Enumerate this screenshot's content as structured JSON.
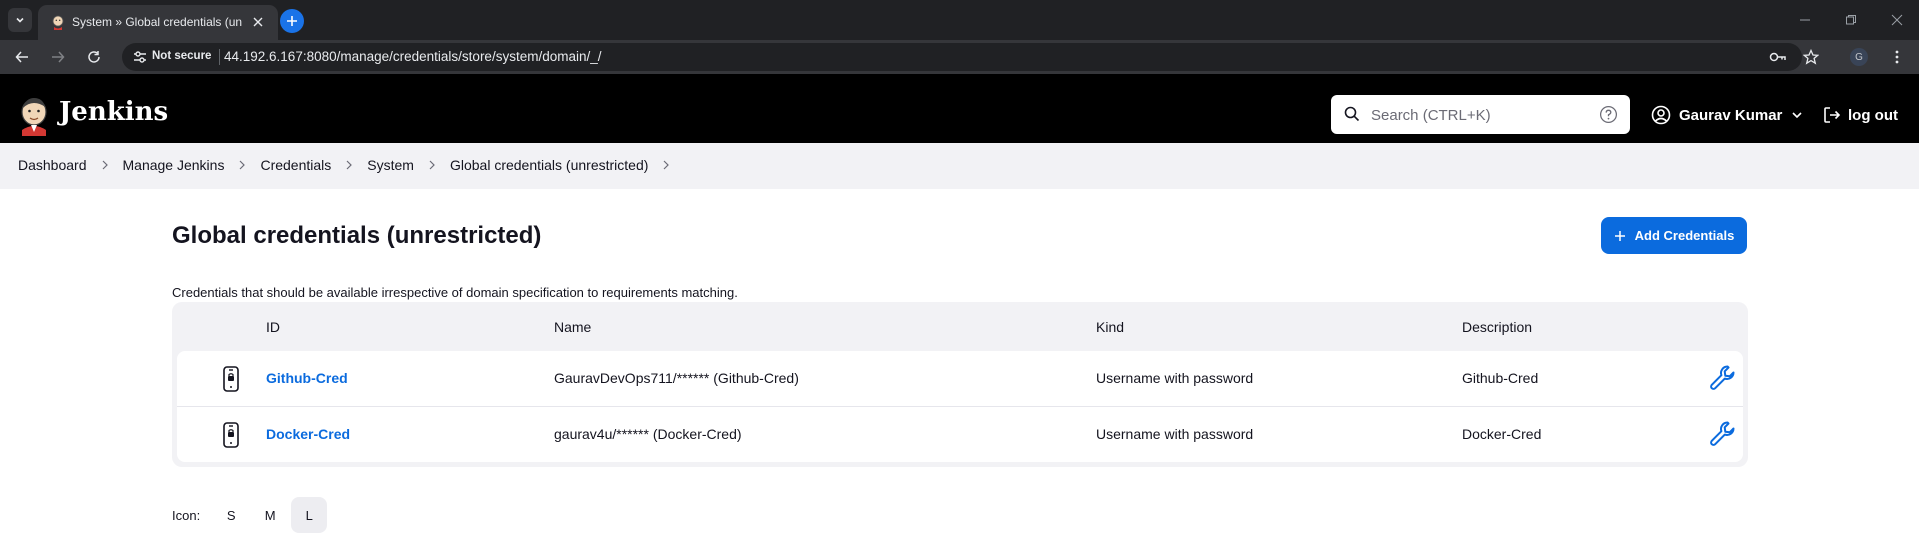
{
  "browser": {
    "tab_title": "System » Global credentials (unrestricted)",
    "security_label": "Not secure",
    "url": "44.192.6.167:8080/manage/credentials/store/system/domain/_/",
    "profile_initial": "G"
  },
  "header": {
    "app_name": "Jenkins",
    "search_placeholder": "Search (CTRL+K)",
    "user_name": "Gaurav Kumar",
    "logout_label": "log out"
  },
  "breadcrumb": [
    "Dashboard",
    "Manage Jenkins",
    "Credentials",
    "System",
    "Global credentials (unrestricted)"
  ],
  "main": {
    "title": "Global credentials (unrestricted)",
    "add_button_label": "Add Credentials",
    "description": "Credentials that should be available irrespective of domain specification to requirements matching.",
    "columns": [
      "ID",
      "Name",
      "Kind",
      "Description"
    ],
    "rows": [
      {
        "id": "Github-Cred",
        "name": "GauravDevOps711/****** (Github-Cred)",
        "kind": "Username with password",
        "description": "Github-Cred"
      },
      {
        "id": "Docker-Cred",
        "name": "gaurav4u/****** (Docker-Cred)",
        "kind": "Username with password",
        "description": "Docker-Cred"
      }
    ],
    "icon_size_label": "Icon:",
    "icon_sizes": [
      "S",
      "M",
      "L"
    ],
    "icon_size_selected": "L"
  },
  "colors": {
    "accent": "#0b6bde",
    "header_bg": "#000000",
    "breadcrumb_bg": "#f2f2f5"
  }
}
